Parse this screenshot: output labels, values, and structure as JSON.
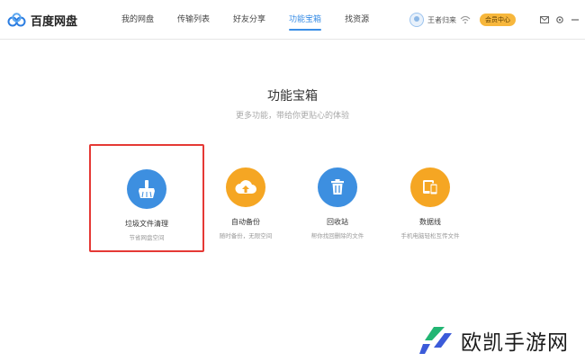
{
  "app": {
    "name": "百度网盘"
  },
  "nav": {
    "items": [
      {
        "label": "我的网盘",
        "active": false
      },
      {
        "label": "传输列表",
        "active": false
      },
      {
        "label": "好友分享",
        "active": false
      },
      {
        "label": "功能宝箱",
        "active": true
      },
      {
        "label": "找资源",
        "active": false
      }
    ]
  },
  "account": {
    "username": "王者归来",
    "vip_label": "会员中心"
  },
  "main": {
    "title": "功能宝箱",
    "subtitle": "更多功能，带给你更贴心的体验"
  },
  "tools": [
    {
      "name": "垃圾文件清理",
      "desc": "节省网盘空间",
      "icon": "broom-icon",
      "color": "#3d8fe0",
      "highlighted": true
    },
    {
      "name": "自动备份",
      "desc": "随时备份，无限空间",
      "icon": "cloud-upload-icon",
      "color": "#f5a623",
      "highlighted": false
    },
    {
      "name": "回收站",
      "desc": "帮你找回删除的文件",
      "icon": "trash-icon",
      "color": "#3d8fe0",
      "highlighted": false
    },
    {
      "name": "数据线",
      "desc": "手机电脑轻松互传文件",
      "icon": "phone-sync-icon",
      "color": "#f5a623",
      "highlighted": false
    }
  ],
  "watermark": {
    "text": "欧凯手游网"
  },
  "colors": {
    "accent": "#3a8ee6",
    "orange": "#f5a623",
    "blue": "#3d8fe0",
    "highlight_border": "#e53935"
  }
}
